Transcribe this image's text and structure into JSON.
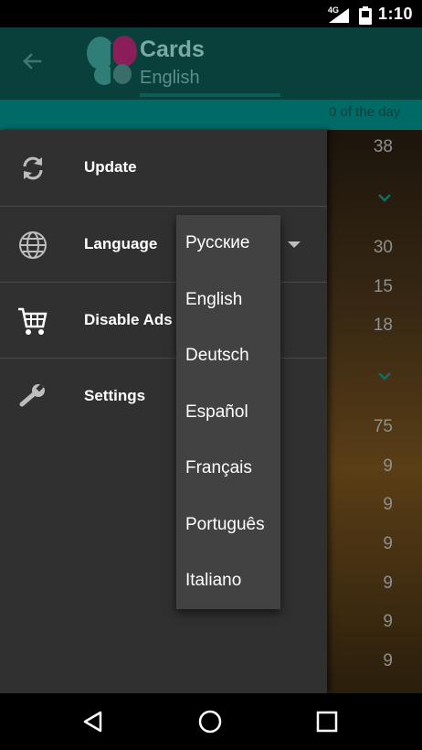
{
  "status_bar": {
    "network": "4G",
    "time": "1:10"
  },
  "app_bar": {
    "title": "Cards",
    "subtitle": "English"
  },
  "strip": {
    "text": "0 of the day"
  },
  "background": {
    "numbers": [
      "38",
      "30",
      "15",
      "18",
      "75",
      "9",
      "9",
      "9",
      "9",
      "9",
      "9"
    ]
  },
  "drawer": {
    "items": [
      {
        "label": "Update",
        "icon": "refresh-icon"
      },
      {
        "label": "Language",
        "icon": "globe-icon"
      },
      {
        "label": "Disable Ads",
        "icon": "cart-icon"
      },
      {
        "label": "Settings",
        "icon": "wrench-icon"
      }
    ]
  },
  "dropdown": {
    "options": [
      "Русские",
      "English",
      "Deutsch",
      "Español",
      "Français",
      "Português",
      "Italiano"
    ]
  },
  "colors": {
    "app_bar": "#0a403c",
    "strip": "#006b66",
    "drawer": "#303030",
    "dropdown": "#424242"
  }
}
